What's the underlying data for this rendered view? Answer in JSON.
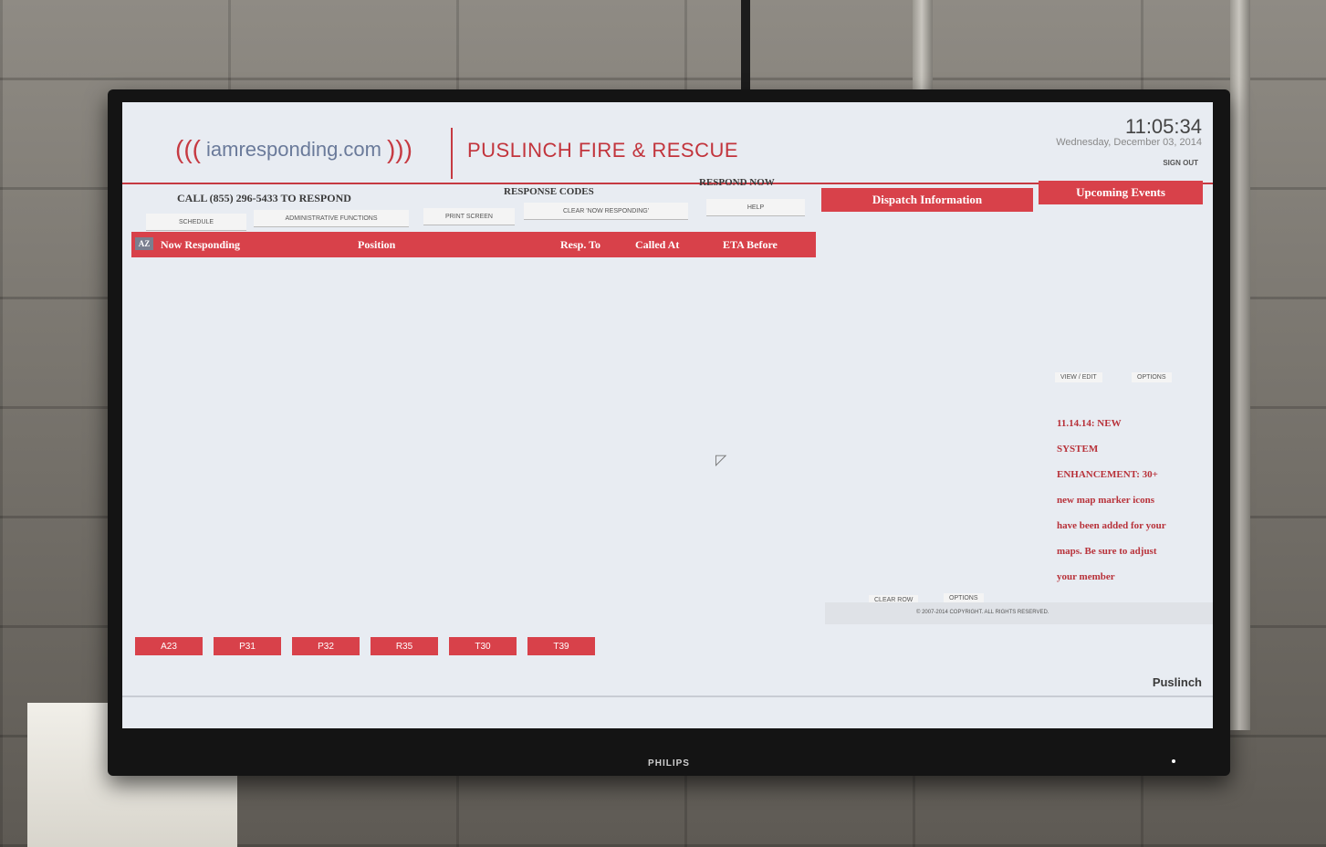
{
  "header": {
    "logo_text": "iamresponding.com",
    "department": "PUSLINCH FIRE & RESCUE",
    "time": "11:05:34",
    "date": "Wednesday, December 03, 2014",
    "sign_out": "SIGN OUT"
  },
  "toolbar": {
    "call_to_respond": "CALL (855) 296-5433 TO RESPOND",
    "response_codes": "RESPONSE CODES",
    "respond_now": "RESPOND NOW",
    "schedule": "SCHEDULE",
    "admin_functions": "ADMINISTRATIVE FUNCTIONS",
    "print_screen": "PRINT SCREEN",
    "clear_now_responding": "CLEAR 'NOW RESPONDING'",
    "help": "HELP"
  },
  "tabs": {
    "dispatch": "Dispatch Information",
    "events": "Upcoming Events"
  },
  "responding_table": {
    "sort_label": "AZ",
    "columns": [
      "Now Responding",
      "Position",
      "Resp. To",
      "Called At",
      "ETA Before"
    ]
  },
  "dispatch_links": {
    "view_edit": "VIEW / EDIT",
    "options": "OPTIONS",
    "clear_row": "CLEAR ROW",
    "options2": "OPTIONS"
  },
  "news": {
    "lines": [
      "11.14.14: NEW",
      "SYSTEM",
      "ENHANCEMENT: 30+",
      "new map marker icons",
      "have been added for your",
      "maps. Be sure to adjust",
      "your member"
    ]
  },
  "footer": {
    "copyright": "© 2007-2014 COPYRIGHT. ALL RIGHTS RESERVED.",
    "agency": "Puslinch"
  },
  "units": [
    "A23",
    "P31",
    "P32",
    "R35",
    "T30",
    "T39"
  ],
  "tv_brand": "PHILIPS",
  "colors": {
    "accent": "#d8414a",
    "screen_bg": "#e8ecf2"
  }
}
